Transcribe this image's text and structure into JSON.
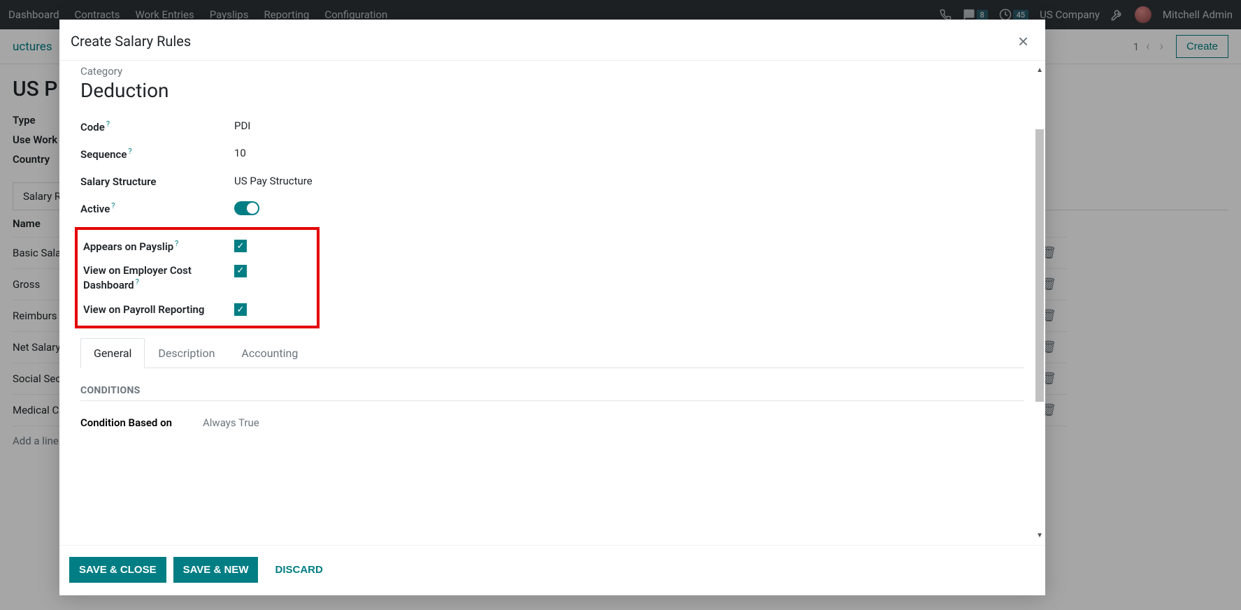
{
  "nav": {
    "items": [
      "Dashboard",
      "Contracts",
      "Work Entries",
      "Payslips",
      "Reporting",
      "Configuration"
    ],
    "msg_badge": "8",
    "clock_badge": "45",
    "company": "US Company",
    "user": "Mitchell Admin"
  },
  "breadcrumb": {
    "left": "uctures",
    "count": "1",
    "create": "Create"
  },
  "bg": {
    "title_partial": "US P",
    "field_type": "Type",
    "field_usework": "Use Work",
    "field_country": "Country",
    "tab_salary": "Salary R",
    "col_name": "Name",
    "rows": [
      "Basic Sala",
      "Gross",
      "Reimburs",
      "Net Salary",
      "Social Sec",
      "Medical C"
    ],
    "add_line": "Add a line"
  },
  "modal": {
    "title": "Create Salary Rules",
    "category_label": "Category",
    "category_value": "Deduction",
    "fields": {
      "code_label": "Code",
      "code_value": "PDI",
      "sequence_label": "Sequence",
      "sequence_value": "10",
      "salary_struct_label": "Salary Structure",
      "salary_struct_value": "US Pay Structure",
      "active_label": "Active",
      "appears_label": "Appears on Payslip",
      "employer_label": "View on Employer Cost Dashboard",
      "payroll_label": "View on Payroll Reporting"
    },
    "tabs": [
      "General",
      "Description",
      "Accounting"
    ],
    "conditions_heading": "CONDITIONS",
    "cond_label": "Condition Based on",
    "cond_value": "Always True",
    "footer": {
      "save_close": "SAVE & CLOSE",
      "save_new": "SAVE & NEW",
      "discard": "DISCARD"
    }
  }
}
